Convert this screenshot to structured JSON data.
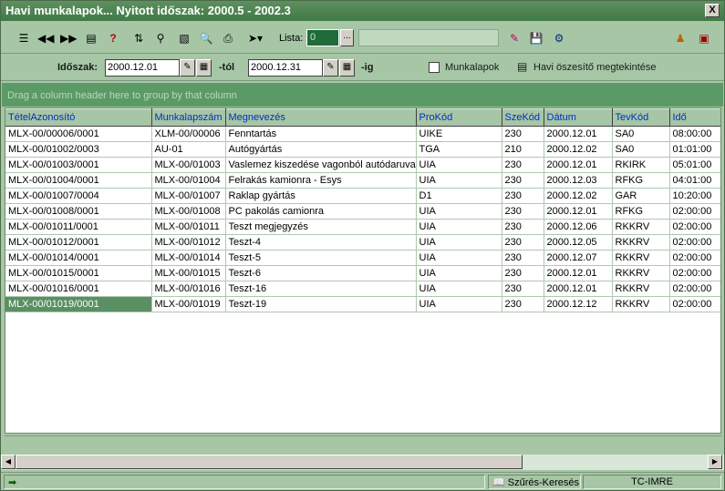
{
  "window": {
    "title": "Havi munkalapok...   Nyitott időszak: 2000.5 - 2002.3",
    "close_label": "X"
  },
  "toolbar": {
    "icons": [
      "tree-icon",
      "rewind-icon",
      "fast-forward-icon",
      "print-preview-icon",
      "help-icon",
      "export-icon",
      "find-icon",
      "copy-icon",
      "preview-icon",
      "print-icon",
      "send-icon"
    ],
    "lista_label": "Lista:",
    "lista_value": "0",
    "lista_dots": "...",
    "right_icons": [
      "eraser-icon",
      "save-icon",
      "filter-icon",
      "user-icon",
      "exit-icon"
    ]
  },
  "filters": {
    "period_label": "Időszak:",
    "from_date": "2000.12.01",
    "from_suffix": "-tól",
    "to_date": "2000.12.31",
    "to_suffix": "-ig",
    "worksheets_label": "Munkalapok",
    "monthly_summary_label": "Havi öszesítő megtekintése"
  },
  "grid": {
    "group_hint": "Drag a column header here to group by that column",
    "columns": [
      "TételAzonosító",
      "Munkalapszám",
      "Megnevezés",
      "ProKód",
      "SzeKód",
      "Dátum",
      "TevKód",
      "Idő"
    ],
    "rows": [
      [
        "MLX-00/00006/0001",
        "XLM-00/00006",
        "Fenntartás",
        "UIKE",
        "230",
        "2000.12.01",
        "SA0",
        "08:00:00"
      ],
      [
        "MLX-00/01002/0003",
        "AU-01",
        "Autógyártás",
        "TGA",
        "210",
        "2000.12.02",
        "SA0",
        "01:01:00"
      ],
      [
        "MLX-00/01003/0001",
        "MLX-00/01003",
        "Vaslemez kiszedése vagonból autódaruval",
        "UIA",
        "230",
        "2000.12.01",
        "RKIRK",
        "05:01:00"
      ],
      [
        "MLX-00/01004/0001",
        "MLX-00/01004",
        "Felrakás kamionra - Esys",
        "UIA",
        "230",
        "2000.12.03",
        "RFKG",
        "04:01:00"
      ],
      [
        "MLX-00/01007/0004",
        "MLX-00/01007",
        "Raklap gyártás",
        "D1",
        "230",
        "2000.12.02",
        "GAR",
        "10:20:00"
      ],
      [
        "MLX-00/01008/0001",
        "MLX-00/01008",
        "PC pakolás camionra",
        "UIA",
        "230",
        "2000.12.01",
        "RFKG",
        "02:00:00"
      ],
      [
        "MLX-00/01011/0001",
        "MLX-00/01011",
        "Teszt megjegyzés",
        "UIA",
        "230",
        "2000.12.06",
        "RKKRV",
        "02:00:00"
      ],
      [
        "MLX-00/01012/0001",
        "MLX-00/01012",
        "Teszt-4",
        "UIA",
        "230",
        "2000.12.05",
        "RKKRV",
        "02:00:00"
      ],
      [
        "MLX-00/01014/0001",
        "MLX-00/01014",
        "Teszt-5",
        "UIA",
        "230",
        "2000.12.07",
        "RKKRV",
        "02:00:00"
      ],
      [
        "MLX-00/01015/0001",
        "MLX-00/01015",
        "Teszt-6",
        "UIA",
        "230",
        "2000.12.01",
        "RKKRV",
        "02:00:00"
      ],
      [
        "MLX-00/01016/0001",
        "MLX-00/01016",
        "Teszt-16",
        "UIA",
        "230",
        "2000.12.01",
        "RKKRV",
        "02:00:00"
      ],
      [
        "MLX-00/01019/0001",
        "MLX-00/01019",
        "Teszt-19",
        "UIA",
        "230",
        "2000.12.12",
        "RKKRV",
        "02:00:00"
      ]
    ],
    "selected_row": 11
  },
  "statusbar": {
    "search_label": "Szűrés-Keresés",
    "user": "TC-IMRE"
  },
  "colors": {
    "title_bar": "#3f7a45",
    "background": "#a6c6a6",
    "group_bar": "#5b9a66",
    "header_text": "#0030c0",
    "selected_cell": "#5a8f63"
  }
}
